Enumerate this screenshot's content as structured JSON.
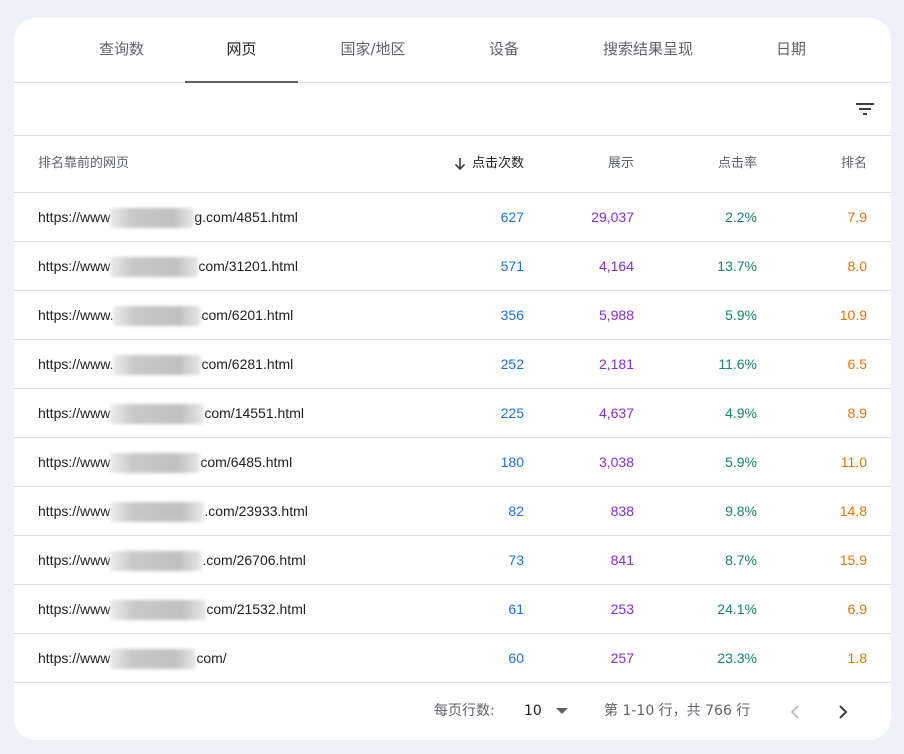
{
  "tabs": [
    {
      "label": "查询数",
      "active": false
    },
    {
      "label": "网页",
      "active": true
    },
    {
      "label": "国家/地区",
      "active": false
    },
    {
      "label": "设备",
      "active": false
    },
    {
      "label": "搜索结果呈现",
      "active": false
    },
    {
      "label": "日期",
      "active": false
    }
  ],
  "toolbar": {
    "filter_icon": "filter-list-icon"
  },
  "table": {
    "headers": {
      "page": "排名靠前的网页",
      "clicks": "点击次数",
      "impressions": "展示",
      "ctr": "点击率",
      "position": "排名"
    },
    "sorted_by": "clicks",
    "sort_icon": "arrow-down-icon",
    "rows": [
      {
        "url_prefix": "https://www",
        "url_suffix": "g.com/4851.html",
        "clicks": "627",
        "impressions": "29,037",
        "ctr": "2.2%",
        "position": "7.9"
      },
      {
        "url_prefix": "https://www",
        "url_suffix": "com/31201.html",
        "clicks": "571",
        "impressions": "4,164",
        "ctr": "13.7%",
        "position": "8.0"
      },
      {
        "url_prefix": "https://www.",
        "url_suffix": "com/6201.html",
        "clicks": "356",
        "impressions": "5,988",
        "ctr": "5.9%",
        "position": "10.9"
      },
      {
        "url_prefix": "https://www.",
        "url_suffix": "com/6281.html",
        "clicks": "252",
        "impressions": "2,181",
        "ctr": "11.6%",
        "position": "6.5"
      },
      {
        "url_prefix": "https://www",
        "url_suffix": "com/14551.html",
        "clicks": "225",
        "impressions": "4,637",
        "ctr": "4.9%",
        "position": "8.9"
      },
      {
        "url_prefix": "https://www",
        "url_suffix": "com/6485.html",
        "clicks": "180",
        "impressions": "3,038",
        "ctr": "5.9%",
        "position": "11.0"
      },
      {
        "url_prefix": "https://www",
        "url_suffix": ".com/23933.html",
        "clicks": "82",
        "impressions": "838",
        "ctr": "9.8%",
        "position": "14.8"
      },
      {
        "url_prefix": "https://www",
        "url_suffix": ".com/26706.html",
        "clicks": "73",
        "impressions": "841",
        "ctr": "8.7%",
        "position": "15.9"
      },
      {
        "url_prefix": "https://www",
        "url_suffix": "com/21532.html",
        "clicks": "61",
        "impressions": "253",
        "ctr": "24.1%",
        "position": "6.9"
      },
      {
        "url_prefix": "https://www",
        "url_suffix": "com/",
        "clicks": "60",
        "impressions": "257",
        "ctr": "23.3%",
        "position": "1.8"
      }
    ]
  },
  "footer": {
    "rows_per_page_label": "每页行数:",
    "rows_per_page_value": "10",
    "range_text": "第 1-10 行，共 766 行",
    "prev_icon": "chevron-left-icon",
    "next_icon": "chevron-right-icon"
  },
  "colors": {
    "clicks": "#1a73e8",
    "impressions": "#8430ce",
    "ctr": "#12846e",
    "position": "#e37400"
  }
}
